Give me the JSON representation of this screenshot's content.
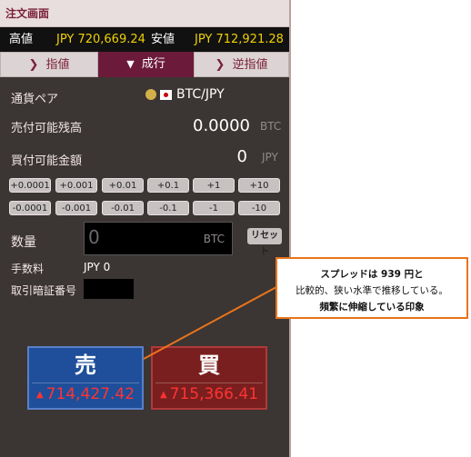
{
  "window": {
    "title": "注文画面"
  },
  "prices": {
    "high_label": "高値",
    "high_value": "JPY 720,669.24",
    "low_label": "安値",
    "low_value": "JPY 712,921.28"
  },
  "tabs": [
    {
      "label": "指値",
      "active": false
    },
    {
      "label": "成行",
      "active": true
    },
    {
      "label": "逆指値",
      "active": false
    }
  ],
  "form": {
    "pair_label": "通貨ペア",
    "pair_value": "BTC/JPY",
    "sell_avail_label": "売付可能残高",
    "sell_avail_value": "0.0000",
    "sell_avail_unit": "BTC",
    "buy_avail_label": "買付可能金額",
    "buy_avail_value": "0",
    "buy_avail_unit": "JPY",
    "increment_buttons": [
      "+0.0001",
      "+0.001",
      "+0.01",
      "+0.1",
      "+1",
      "+10"
    ],
    "decrement_buttons": [
      "-0.0001",
      "-0.001",
      "-0.01",
      "-0.1",
      "-1",
      "-10"
    ],
    "qty_label": "数量",
    "qty_value": "0",
    "qty_unit": "BTC",
    "reset_label": "リセット",
    "fee_label": "手数料",
    "fee_value": "JPY 0",
    "pin_label": "取引暗証番号",
    "pin_value": ""
  },
  "trade": {
    "sell_label": "売",
    "sell_price": "714,427.42",
    "buy_label": "買",
    "buy_price": "715,366.41"
  },
  "callout": {
    "line1": "スプレッドは 939 円と",
    "line2": "比較的、狭い水準で推移している。",
    "line3": "頻繁に伸縮している印象"
  },
  "colors": {
    "panel_bg": "#3b3533",
    "active_tab": "#6b1a3a",
    "sell_bg": "#1f4f9a",
    "buy_bg": "#7a1f1f",
    "price_red": "#ff3333",
    "callout_border": "#e8741c",
    "highlight_yellow": "#f0d000"
  }
}
